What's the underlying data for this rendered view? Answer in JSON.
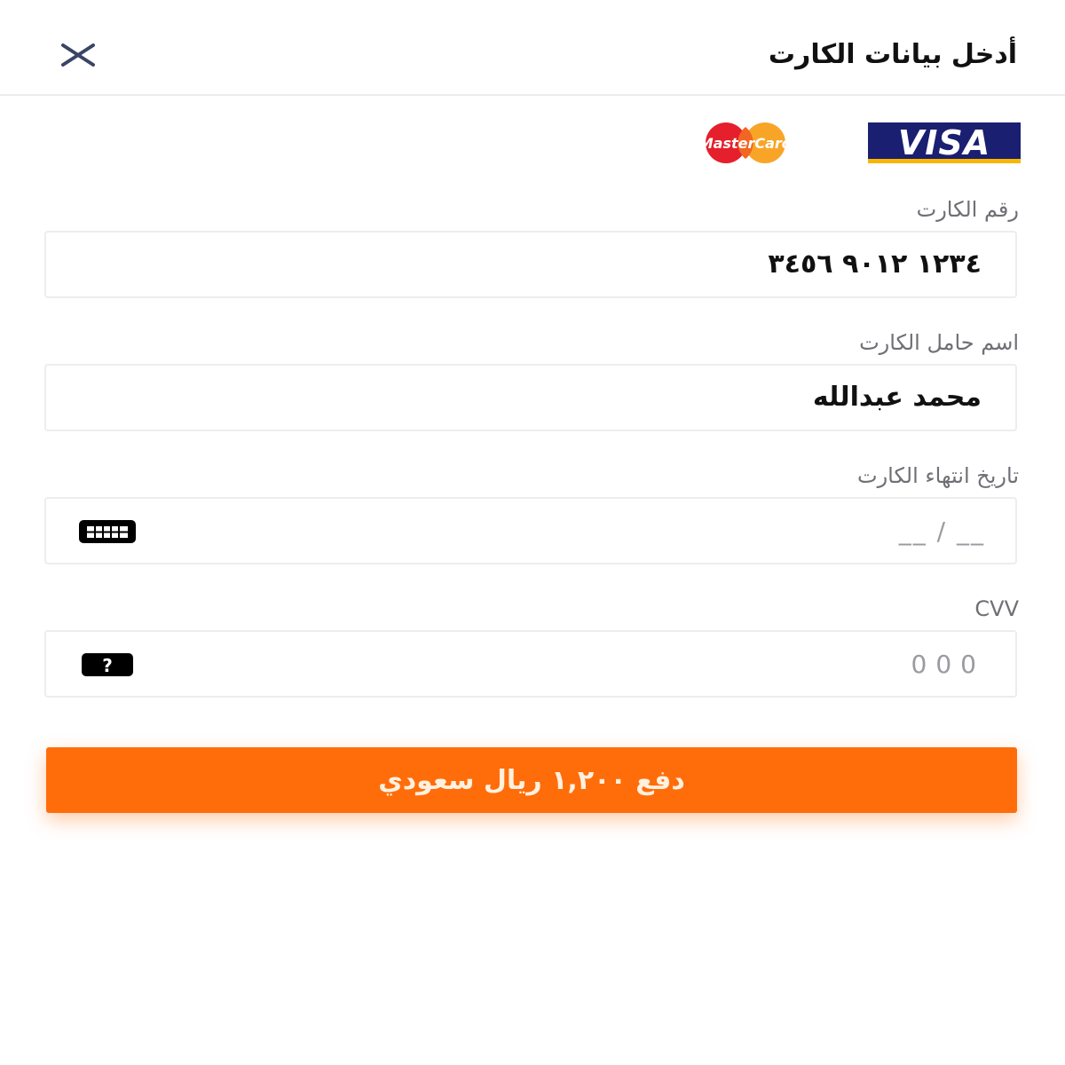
{
  "header": {
    "title": "أدخل بيانات الكارت",
    "close_icon": "close-icon"
  },
  "card_brands": {
    "visa": "VISA",
    "mastercard": "MasterCard"
  },
  "fields": {
    "card_number": {
      "label": "رقم الكارت",
      "value": "١٢٣٤ ٩٠١٢ ٣٤٥٦"
    },
    "holder_name": {
      "label": "اسم حامل الكارت",
      "value": "محمد عبدالله"
    },
    "expiry": {
      "label": "تاريخ انتهاء الكارت",
      "placeholder": "__ / __",
      "icon": "calendar-icon"
    },
    "cvv": {
      "label": "CVV",
      "placeholder": "000",
      "icon": "help-icon"
    }
  },
  "pay_button": {
    "label": "دفع ١,٢٠٠ ريال سعودي"
  },
  "colors": {
    "accent": "#ff6d0b",
    "visa_blue": "#1a1f71",
    "title": "#111111",
    "label": "#6f6f75"
  }
}
